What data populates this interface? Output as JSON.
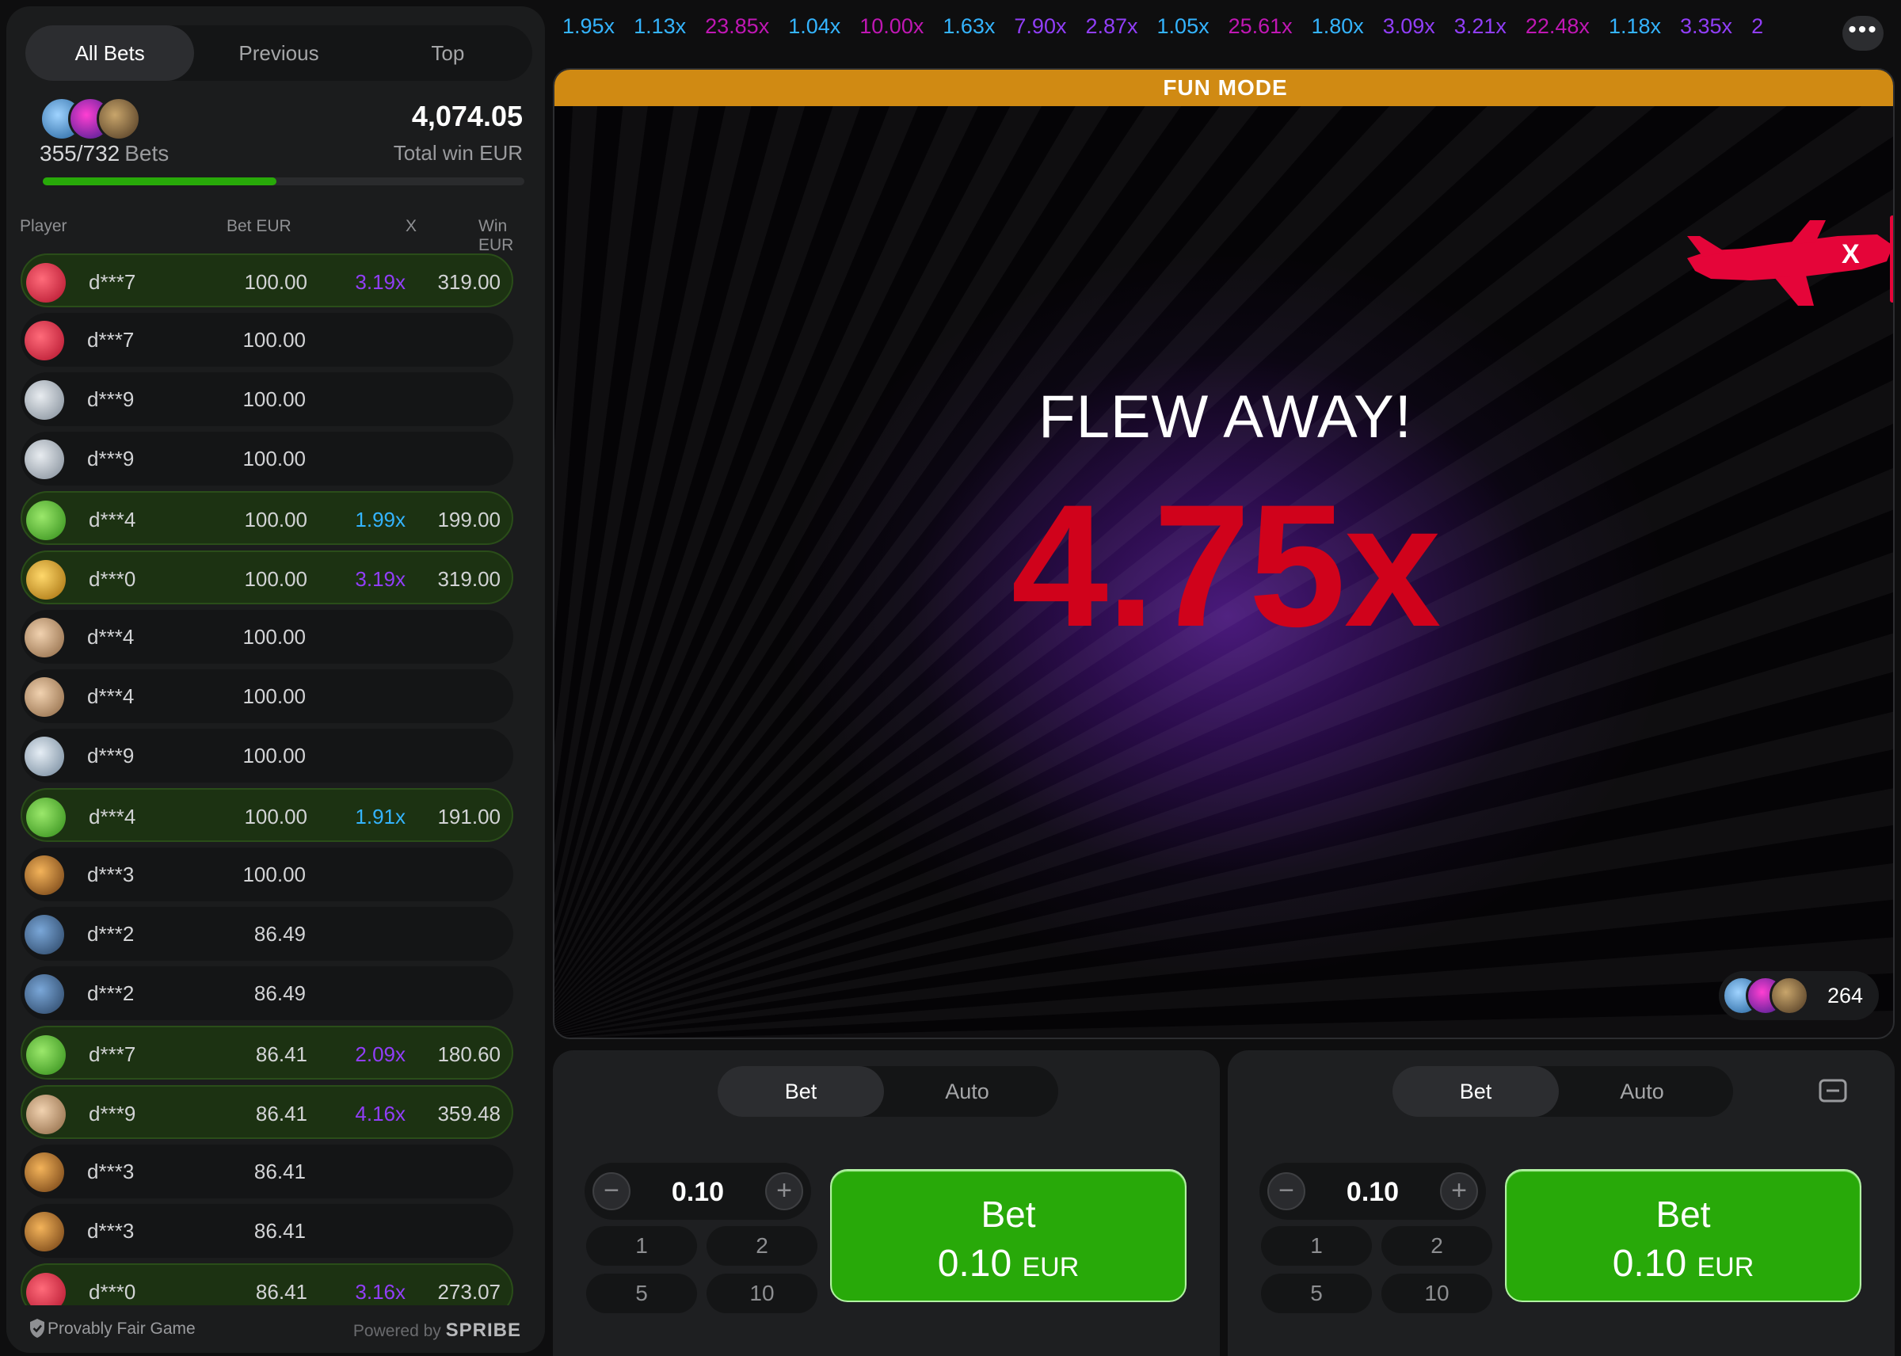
{
  "left_tabs": [
    "All Bets",
    "Previous",
    "Top"
  ],
  "summary": {
    "bets_count": "355/732",
    "bets_label": "Bets",
    "total_win": "4,074.05",
    "total_win_label": "Total win EUR",
    "progress_fraction": 0.485
  },
  "columns": {
    "player": "Player",
    "bet": "Bet EUR",
    "mult": "X",
    "win": "Win EUR"
  },
  "rows": [
    {
      "player": "d***7",
      "bet": "100.00",
      "mult": "3.19x",
      "win": "319.00",
      "avatar": "red-ball",
      "mult_color": "#913ef8"
    },
    {
      "player": "d***7",
      "bet": "100.00",
      "mult": "",
      "win": "",
      "avatar": "red-ball",
      "mult_color": ""
    },
    {
      "player": "d***9",
      "bet": "100.00",
      "mult": "",
      "win": "",
      "avatar": "jet",
      "mult_color": ""
    },
    {
      "player": "d***9",
      "bet": "100.00",
      "mult": "",
      "win": "",
      "avatar": "jet",
      "mult_color": ""
    },
    {
      "player": "d***4",
      "bet": "100.00",
      "mult": "1.99x",
      "win": "199.00",
      "avatar": "clover",
      "mult_color": "#34b4ff"
    },
    {
      "player": "d***0",
      "bet": "100.00",
      "mult": "3.19x",
      "win": "319.00",
      "avatar": "gold",
      "mult_color": "#913ef8"
    },
    {
      "player": "d***4",
      "bet": "100.00",
      "mult": "",
      "win": "",
      "avatar": "lion",
      "mult_color": ""
    },
    {
      "player": "d***4",
      "bet": "100.00",
      "mult": "",
      "win": "",
      "avatar": "lion",
      "mult_color": ""
    },
    {
      "player": "d***9",
      "bet": "100.00",
      "mult": "",
      "win": "",
      "avatar": "snow",
      "mult_color": ""
    },
    {
      "player": "d***4",
      "bet": "100.00",
      "mult": "1.91x",
      "win": "191.00",
      "avatar": "clover",
      "mult_color": "#34b4ff"
    },
    {
      "player": "d***3",
      "bet": "100.00",
      "mult": "",
      "win": "",
      "avatar": "tiger",
      "mult_color": ""
    },
    {
      "player": "d***2",
      "bet": "86.49",
      "mult": "",
      "win": "",
      "avatar": "cool",
      "mult_color": ""
    },
    {
      "player": "d***2",
      "bet": "86.49",
      "mult": "",
      "win": "",
      "avatar": "cool",
      "mult_color": ""
    },
    {
      "player": "d***7",
      "bet": "86.41",
      "mult": "2.09x",
      "win": "180.60",
      "avatar": "clover",
      "mult_color": "#913ef8"
    },
    {
      "player": "d***9",
      "bet": "86.41",
      "mult": "4.16x",
      "win": "359.48",
      "avatar": "lion",
      "mult_color": "#913ef8"
    },
    {
      "player": "d***3",
      "bet": "86.41",
      "mult": "",
      "win": "",
      "avatar": "tiger",
      "mult_color": ""
    },
    {
      "player": "d***3",
      "bet": "86.41",
      "mult": "",
      "win": "",
      "avatar": "tiger",
      "mult_color": ""
    },
    {
      "player": "d***0",
      "bet": "86.41",
      "mult": "3.16x",
      "win": "273.07",
      "avatar": "red-ball",
      "mult_color": "#913ef8"
    }
  ],
  "footer": {
    "provably": "Provably Fair Game",
    "powered_by": "Powered by",
    "brand": "SPRIBE"
  },
  "history": [
    {
      "v": "1.95x",
      "c": "#34b4ff"
    },
    {
      "v": "1.13x",
      "c": "#34b4ff"
    },
    {
      "v": "23.85x",
      "c": "#c017b4"
    },
    {
      "v": "1.04x",
      "c": "#34b4ff"
    },
    {
      "v": "10.00x",
      "c": "#c017b4"
    },
    {
      "v": "1.63x",
      "c": "#34b4ff"
    },
    {
      "v": "7.90x",
      "c": "#913ef8"
    },
    {
      "v": "2.87x",
      "c": "#913ef8"
    },
    {
      "v": "1.05x",
      "c": "#34b4ff"
    },
    {
      "v": "25.61x",
      "c": "#c017b4"
    },
    {
      "v": "1.80x",
      "c": "#34b4ff"
    },
    {
      "v": "3.09x",
      "c": "#913ef8"
    },
    {
      "v": "3.21x",
      "c": "#913ef8"
    },
    {
      "v": "22.48x",
      "c": "#c017b4"
    },
    {
      "v": "1.18x",
      "c": "#34b4ff"
    },
    {
      "v": "3.35x",
      "c": "#913ef8"
    },
    {
      "v": "2",
      "c": "#913ef8"
    }
  ],
  "game": {
    "mode_banner": "FUN MODE",
    "status": "FLEW AWAY!",
    "multiplier": "4.75x",
    "online_count": "264"
  },
  "panels": [
    {
      "tab_bet": "Bet",
      "tab_auto": "Auto",
      "amount": "0.10",
      "quick": [
        "1",
        "2",
        "5",
        "10"
      ],
      "btn_label": "Bet",
      "btn_amount": "0.10",
      "btn_currency": "EUR"
    },
    {
      "tab_bet": "Bet",
      "tab_auto": "Auto",
      "amount": "0.10",
      "quick": [
        "1",
        "2",
        "5",
        "10"
      ],
      "btn_label": "Bet",
      "btn_amount": "0.10",
      "btn_currency": "EUR"
    }
  ],
  "colors": {
    "accent_green": "#28a909",
    "crash_red": "#d0021b",
    "fun_mode": "#d08a13",
    "blue_mult": "#34b4ff",
    "purple_mult": "#913ef8",
    "magenta_mult": "#c017b4"
  }
}
